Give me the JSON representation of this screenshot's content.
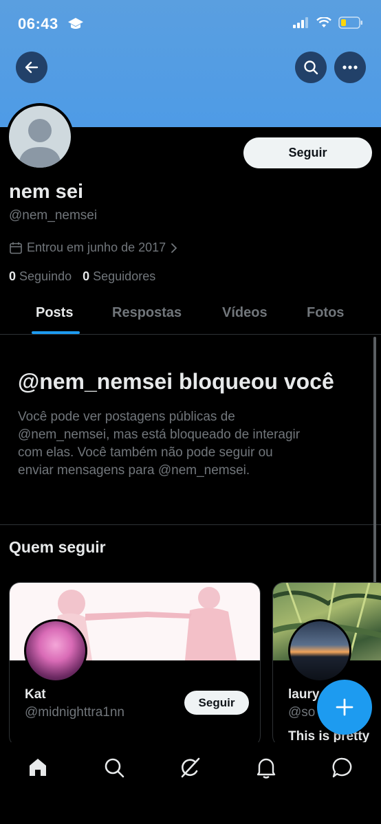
{
  "status_bar": {
    "time": "06:43",
    "icons": [
      "graduation-cap-icon",
      "cellular-signal-icon",
      "wifi-icon",
      "battery-low-icon"
    ]
  },
  "header": {
    "back_icon": "arrow-left-icon",
    "search_icon": "search-icon",
    "more_icon": "more-horizontal-icon",
    "banner_color": "#5a9fe0"
  },
  "profile": {
    "display_name": "nem sei",
    "handle": "@nem_nemsei",
    "follow_label": "Seguir",
    "joined": "Entrou em junho de 2017",
    "following_count": "0",
    "following_label": "Seguindo",
    "followers_count": "0",
    "followers_label": "Seguidores"
  },
  "tabs": [
    {
      "label": "Posts",
      "active": true
    },
    {
      "label": "Respostas",
      "active": false
    },
    {
      "label": "Vídeos",
      "active": false
    },
    {
      "label": "Fotos",
      "active": false
    }
  ],
  "blocked": {
    "title": "@nem_nemsei bloqueou você",
    "lines": [
      "Você pode ver postagens públicas de",
      "@nem_nemsei, mas está bloqueado de interagir",
      "com elas. Você também não pode seguir ou",
      "enviar mensagens para @nem_nemsei."
    ]
  },
  "who_to_follow": {
    "title": "Quem seguir",
    "cards": [
      {
        "name": "Kat",
        "handle": "@midnighttra1nn",
        "follow_label": "Seguir",
        "bio": ""
      },
      {
        "name": "laury",
        "handle": "@so",
        "follow_label": "",
        "bio": "This is pretty"
      }
    ]
  },
  "fab": {
    "icon": "plus-icon"
  },
  "bottom_nav": [
    {
      "icon": "home-icon",
      "active": true
    },
    {
      "icon": "search-icon",
      "active": false
    },
    {
      "icon": "grok-icon",
      "active": false
    },
    {
      "icon": "bell-icon",
      "active": false
    },
    {
      "icon": "message-icon",
      "active": false
    }
  ],
  "colors": {
    "accent": "#1d9bf0",
    "background": "#000000",
    "muted_text": "#71767b",
    "primary_text": "#e7e9ea"
  }
}
